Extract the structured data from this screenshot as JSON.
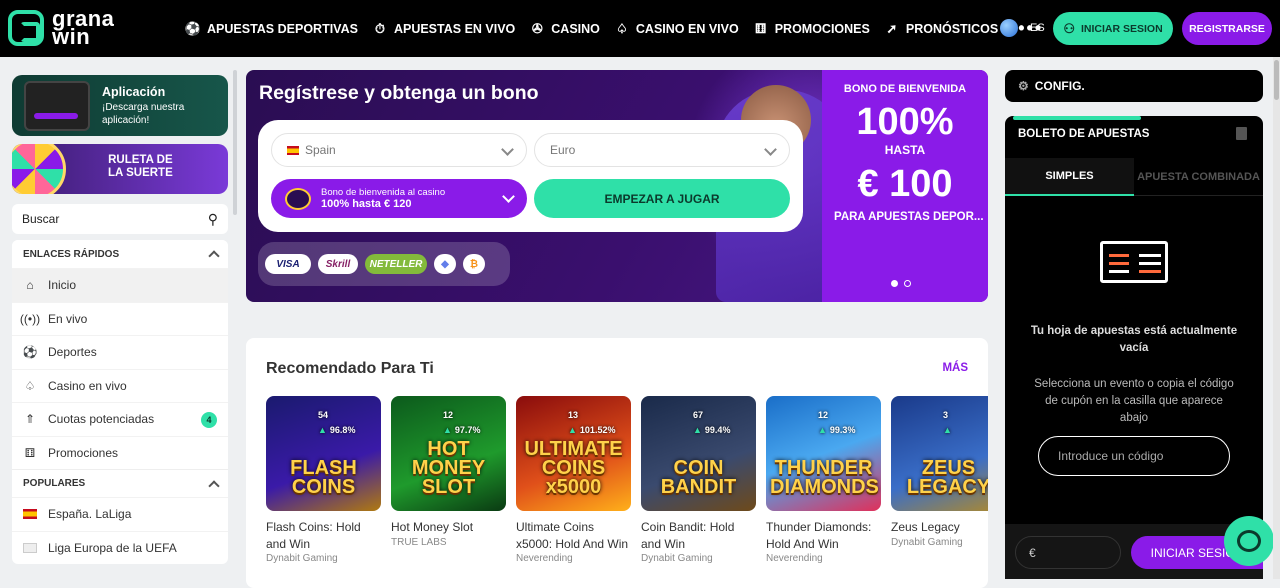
{
  "brand": {
    "logo_line1": "grana",
    "logo_line2": "win",
    "accent": "#2fe0a8",
    "purple": "#8a1be8"
  },
  "nav": {
    "items": [
      {
        "label": "APUESTAS DEPORTIVAS",
        "icon": "soccer-ball-icon"
      },
      {
        "label": "APUESTAS EN VIVO",
        "icon": "live-stopwatch-icon"
      },
      {
        "label": "CASINO",
        "icon": "roulette-icon"
      },
      {
        "label": "CASINO EN VIVO",
        "icon": "live-casino-icon"
      },
      {
        "label": "PROMOCIONES",
        "icon": "gift-icon"
      },
      {
        "label": "PRONÓSTICOS",
        "icon": "cursor-icon"
      }
    ],
    "more": "•••",
    "lang": "ES",
    "login": "INICIAR SESION",
    "register": "REGISTRARSE"
  },
  "sidebar": {
    "app_title": "Aplicación",
    "app_sub": "¡Descarga nuestra aplicación!",
    "roulette_l1": "RULETA DE",
    "roulette_l2": "LA SUERTE",
    "search_placeholder": "Buscar",
    "quick_links_head": "ENLACES RÁPIDOS",
    "quick_links": [
      {
        "label": "Inicio",
        "icon": "home-icon"
      },
      {
        "label": "En vivo",
        "icon": "broadcast-icon"
      },
      {
        "label": "Deportes",
        "icon": "soccer-ball-icon"
      },
      {
        "label": "Casino en vivo",
        "icon": "live-casino-icon"
      },
      {
        "label": "Cuotas potenciadas",
        "icon": "boost-icon",
        "badge": "4"
      },
      {
        "label": "Promociones",
        "icon": "gift-icon"
      }
    ],
    "popular_head": "POPULARES",
    "popular": [
      {
        "label": "España. LaLiga"
      },
      {
        "label": "Liga Europa de la UEFA"
      }
    ]
  },
  "banner": {
    "title": "Regístrese y obtenga un bono",
    "country": "Spain",
    "currency": "Euro",
    "bonus_l1": "Bono de bienvenida al casino",
    "bonus_l2": "100% hasta € 120",
    "play": "EMPEZAR A JUGAR",
    "payments": [
      "VISA",
      "Skrill",
      "NETELLER",
      "◆",
      "₿"
    ],
    "welcome_top": "BONO DE BIENVENIDA",
    "welcome_pct": "100%",
    "welcome_mid": "HASTA",
    "welcome_amt": "€ 100",
    "welcome_bot": "PARA APUESTAS DEPOR..."
  },
  "reco": {
    "title": "Recomendado Para Ti",
    "more": "MÁS",
    "games": [
      {
        "thumb": "FLASH COINS",
        "count": "54",
        "rtp": "96.8%",
        "name": "Flash Coins: Hold and Win",
        "provider": "Dynabit Gaming",
        "bg": "linear-gradient(160deg,#1a1a6e,#3a1aa8 60%,#b07a10)"
      },
      {
        "thumb": "HOT MONEY SLOT",
        "count": "12",
        "rtp": "97.7%",
        "name": "Hot Money Slot",
        "provider": "TRUE LABS",
        "bg": "linear-gradient(160deg,#0c5a1c,#1f9a2c 60%,#0a3a12)"
      },
      {
        "thumb": "ULTIMATE COINS x5000",
        "count": "13",
        "rtp": "101.52%",
        "name": "Ultimate Coins x5000: Hold And Win",
        "provider": "Neverending",
        "bg": "linear-gradient(160deg,#8a0c0c,#e0501a 60%,#ffb01a)"
      },
      {
        "thumb": "COIN BANDIT",
        "count": "67",
        "rtp": "99.4%",
        "name": "Coin Bandit: Hold and Win",
        "provider": "Dynabit Gaming",
        "bg": "linear-gradient(160deg,#1a2a4a,#3a4a6e 60%,#6e4a1a)"
      },
      {
        "thumb": "THUNDER DIAMONDS",
        "count": "12",
        "rtp": "99.3%",
        "name": "Thunder Diamonds: Hold And Win",
        "provider": "Neverending",
        "bg": "linear-gradient(160deg,#1a6ec8,#4aa8f0 50%,#e0305a)"
      },
      {
        "thumb": "ZEUS LEGACY",
        "count": "3",
        "rtp": "",
        "name": "Zeus Legacy",
        "provider": "Dynabit Gaming",
        "bg": "linear-gradient(160deg,#1a3a8a,#3a6ec8 60%,#b08a2a)"
      }
    ]
  },
  "betslip": {
    "config": "CONFIG.",
    "title": "BOLETO DE APUESTAS",
    "tab_single": "SIMPLES",
    "tab_combo": "APUESTA COMBINADA",
    "empty_title": "Tu hoja de apuestas está actualmente vacía",
    "empty_desc": "Selecciona un evento o copia el código de cupón en la casilla que aparece abajo",
    "code_placeholder": "Introduce un código",
    "currency": "€",
    "login": "INICIAR SESION"
  }
}
